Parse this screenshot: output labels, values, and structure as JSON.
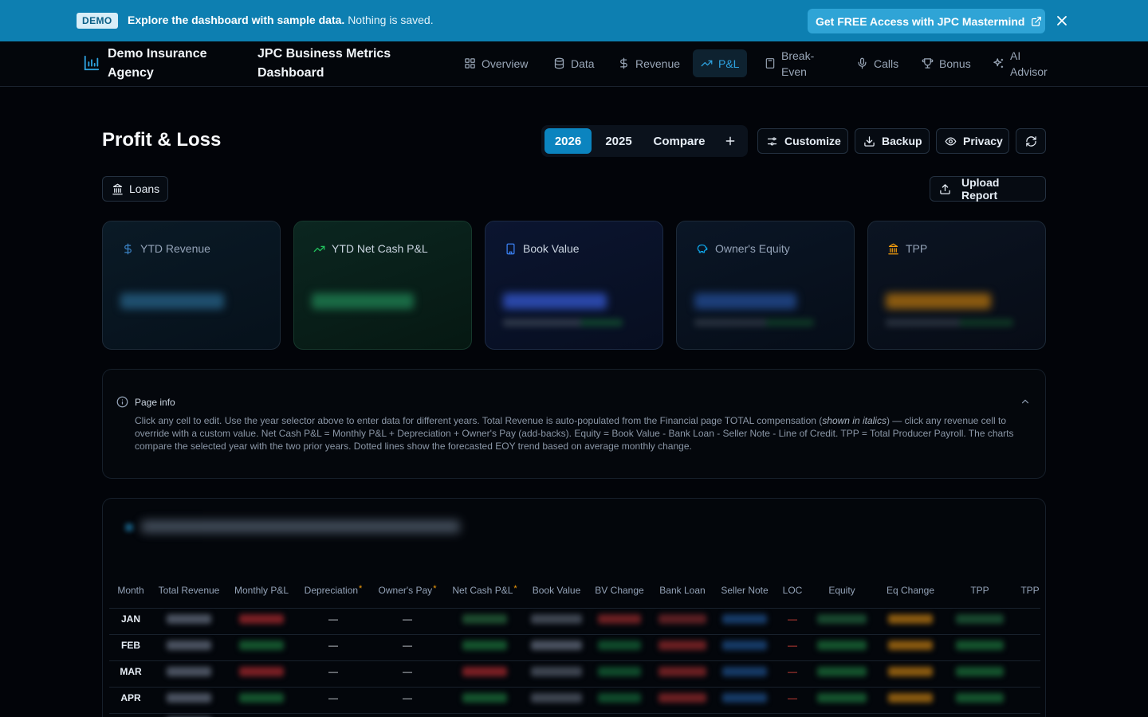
{
  "banner": {
    "badge": "DEMO",
    "message_strong": "Explore the dashboard with sample data.",
    "message_soft": "Nothing is saved.",
    "cta_label": "Get FREE Access with JPC Mastermind"
  },
  "nav": {
    "brand": "Demo Insurance Agency",
    "app_title": "JPC Business Metrics Dashboard",
    "items": [
      {
        "label": "Overview",
        "icon": "grid-icon"
      },
      {
        "label": "Data",
        "icon": "database-icon"
      },
      {
        "label": "Revenue",
        "icon": "dollar-icon"
      },
      {
        "label": "P&L",
        "icon": "trending-up-icon",
        "active": true
      },
      {
        "label": "Break-Even",
        "icon": "calculator-icon"
      },
      {
        "label": "Calls",
        "icon": "mic-icon"
      },
      {
        "label": "Bonus",
        "icon": "trophy-icon"
      },
      {
        "label": "AI Advisor",
        "icon": "sparkles-icon"
      }
    ]
  },
  "header": {
    "title": "Profit & Loss",
    "years": [
      "2026",
      "2025"
    ],
    "selected_year": "2026",
    "compare_label": "Compare",
    "add_label": "+",
    "customize_label": "Customize",
    "backup_label": "Backup",
    "privacy_label": "Privacy",
    "loans_label": "Loans",
    "upload_label": "Upload Report"
  },
  "kpis": [
    {
      "label": "YTD Revenue",
      "icon": "dollar-icon",
      "color": "#3b82c4"
    },
    {
      "label": "YTD Net Cash P&L",
      "icon": "trending-up-icon",
      "color": "#22c55e"
    },
    {
      "label": "Book Value",
      "icon": "building-icon",
      "color": "#3b82f6"
    },
    {
      "label": "Owner's Equity",
      "icon": "piggy-bank-icon",
      "color": "#0ea5e9"
    },
    {
      "label": "TPP",
      "icon": "landmark-icon",
      "color": "#f59e0b"
    }
  ],
  "page_info": {
    "title": "Page info",
    "text_1": "Click any cell to edit. Use the year selector above to enter data for different years. Total Revenue is auto-populated from the Financial page TOTAL compensation (",
    "text_italic": "shown in italics",
    "text_2": ") — click any revenue cell to override with a custom value. Net Cash P&L = Monthly P&L + Depreciation + Owner's Pay (add-backs). Equity = Book Value - Bank Loan - Seller Note - Line of Credit. TPP = Total Producer Payroll. The charts compare the selected year with the two prior years. Dotted lines show the forecasted EOY trend based on average monthly change."
  },
  "table": {
    "columns": [
      "Month",
      "Total Revenue",
      "Monthly P&L",
      "Depreciation",
      "Owner's Pay",
      "Net Cash P&L",
      "Book Value",
      "BV Change",
      "Bank Loan",
      "Seller Note",
      "LOC",
      "Equity",
      "Eq Change",
      "TPP",
      "TPP"
    ],
    "required_marker": "*",
    "rows": [
      {
        "month": "JAN",
        "depreciation": "—",
        "owners_pay": "—",
        "loc": "—"
      },
      {
        "month": "FEB",
        "depreciation": "—",
        "owners_pay": "—",
        "loc": "—"
      },
      {
        "month": "MAR",
        "depreciation": "—",
        "owners_pay": "—",
        "loc": "—"
      },
      {
        "month": "APR",
        "depreciation": "—",
        "owners_pay": "—",
        "loc": "—"
      }
    ]
  },
  "colors": {
    "banner": "#0d7fb1",
    "accent": "#0b84bf",
    "positive": "#22c55e",
    "negative": "#ef4444",
    "tpp": "#f59e0b"
  }
}
